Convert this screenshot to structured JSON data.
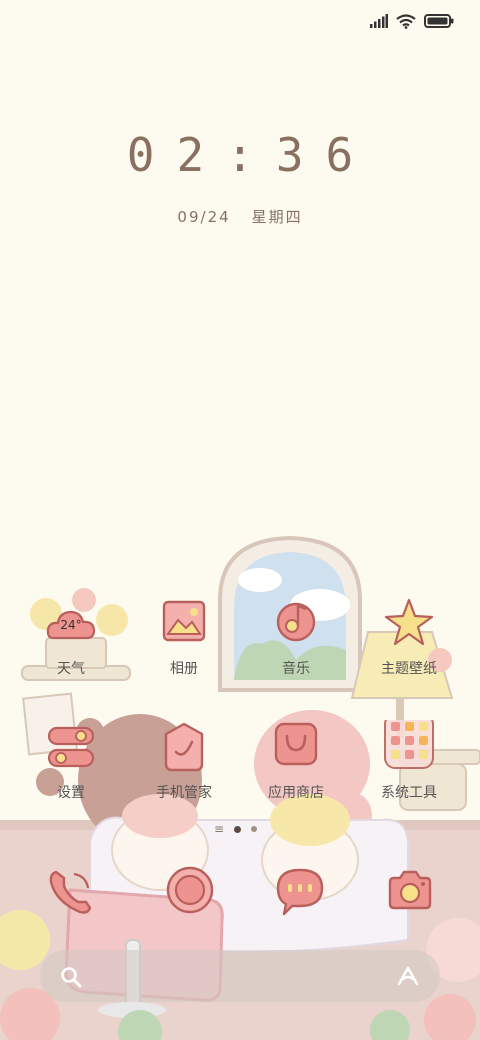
{
  "clock": {
    "time": "02:36"
  },
  "date": {
    "day": "09/24",
    "weekday": "星期四"
  },
  "weather": {
    "temp": "24°"
  },
  "apps": [
    {
      "label": "天气",
      "icon": "weather-cloud-icon"
    },
    {
      "label": "相册",
      "icon": "gallery-icon"
    },
    {
      "label": "音乐",
      "icon": "music-note-icon"
    },
    {
      "label": "主题壁纸",
      "icon": "star-theme-icon"
    },
    {
      "label": "设置",
      "icon": "settings-toggle-icon"
    },
    {
      "label": "手机管家",
      "icon": "shield-check-icon"
    },
    {
      "label": "应用商店",
      "icon": "store-bag-icon"
    },
    {
      "label": "系统工具",
      "icon": "tools-folder-icon"
    }
  ],
  "dock": [
    {
      "icon": "phone-icon"
    },
    {
      "icon": "camera-shutter-icon"
    },
    {
      "icon": "message-bubble-icon"
    },
    {
      "icon": "camera-icon"
    }
  ],
  "colors": {
    "accent": "#e98b8b",
    "accentLight": "#f7c8c4",
    "text": "#555555",
    "clock": "#8a7060"
  }
}
